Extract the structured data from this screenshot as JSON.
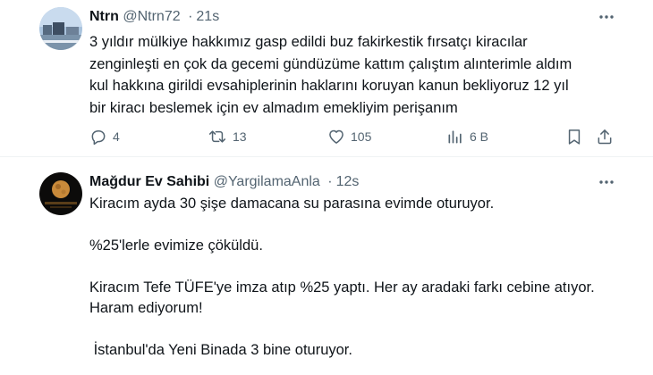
{
  "tweets": [
    {
      "display_name": "Ntrn",
      "handle": "@Ntrn72",
      "separator": "·",
      "time": "21s",
      "lines": [
        "3 yıldır mülkiye hakkımız gasp edildi buz fakirkestik fırsatçı kiracılar",
        "zenginleşti en çok da gecemi gündüzüme kattım çalıştım alınterimle aldım",
        "kul hakkına girildi  evsahiplerinin haklarını koruyan kanun bekliyoruz 12 yıl",
        "bir kiracı beslemek için ev almadım emekliyim perişanım"
      ],
      "actions": {
        "replies": "4",
        "retweets": "13",
        "likes": "105",
        "views": "6 B"
      }
    },
    {
      "display_name": "Mağdur Ev Sahibi",
      "handle": "@YargilamaAnla",
      "separator": "·",
      "time": "12s",
      "paragraphs": [
        "Kiracım ayda 30 şişe damacana su parasına evimde oturuyor.",
        "%25'lerle evimize çöküldü.",
        "Kiracım Tefe TÜFE'ye imza atıp %25 yaptı. Her ay aradaki farkı cebine atıyor.\nHaram ediyorum!",
        " İstanbul'da Yeni Binada 3 bine oturuyor."
      ]
    }
  ],
  "colors": {
    "text": "#0f1419",
    "secondary": "#536471",
    "divider": "#eff3f4"
  },
  "icons": {
    "reply": "reply-icon",
    "retweet": "retweet-icon",
    "like": "heart-icon",
    "views": "views-chart-icon",
    "bookmark": "bookmark-icon",
    "share": "share-icon",
    "more": "more-icon"
  }
}
